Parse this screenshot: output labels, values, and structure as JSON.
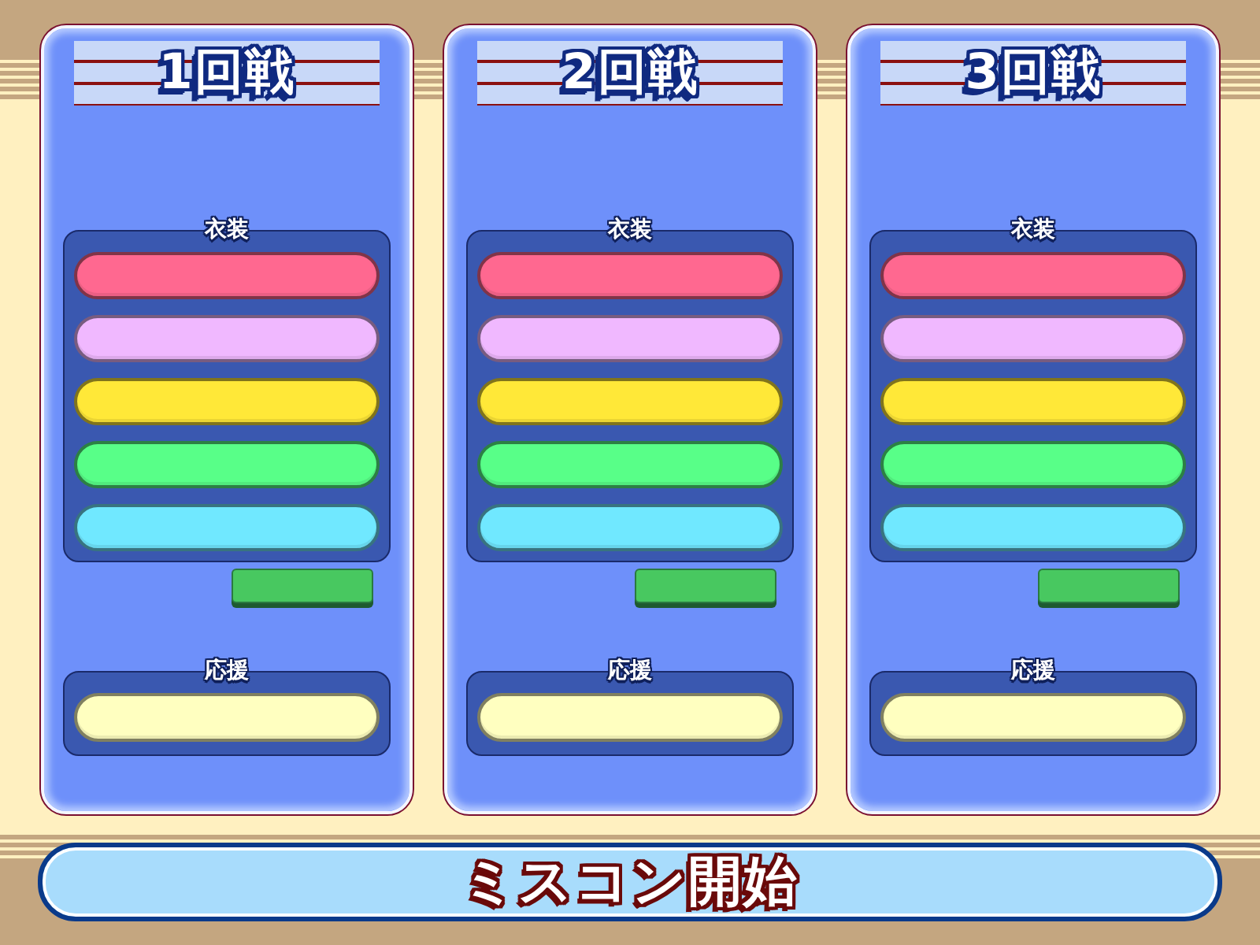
{
  "rounds": [
    {
      "title": "1回戦",
      "costume": {
        "label": "衣装",
        "slots": [
          {
            "color": "#ff6890"
          },
          {
            "color": "#f0b8ff"
          },
          {
            "color": "#ffe838"
          },
          {
            "color": "#58ff88"
          },
          {
            "color": "#70e8ff"
          }
        ]
      },
      "cheer": {
        "label": "応援",
        "slots": [
          {
            "color": "#ffffc0"
          }
        ]
      }
    },
    {
      "title": "2回戦",
      "costume": {
        "label": "衣装",
        "slots": [
          {
            "color": "#ff6890"
          },
          {
            "color": "#f0b8ff"
          },
          {
            "color": "#ffe838"
          },
          {
            "color": "#58ff88"
          },
          {
            "color": "#70e8ff"
          }
        ]
      },
      "cheer": {
        "label": "応援",
        "slots": [
          {
            "color": "#ffffc0"
          }
        ]
      }
    },
    {
      "title": "3回戦",
      "costume": {
        "label": "衣装",
        "slots": [
          {
            "color": "#ff6890"
          },
          {
            "color": "#f0b8ff"
          },
          {
            "color": "#ffe838"
          },
          {
            "color": "#58ff88"
          },
          {
            "color": "#70e8ff"
          }
        ]
      },
      "cheer": {
        "label": "応援",
        "slots": [
          {
            "color": "#ffffc0"
          }
        ]
      }
    }
  ],
  "start_button": {
    "label": "ミスコン開始"
  }
}
